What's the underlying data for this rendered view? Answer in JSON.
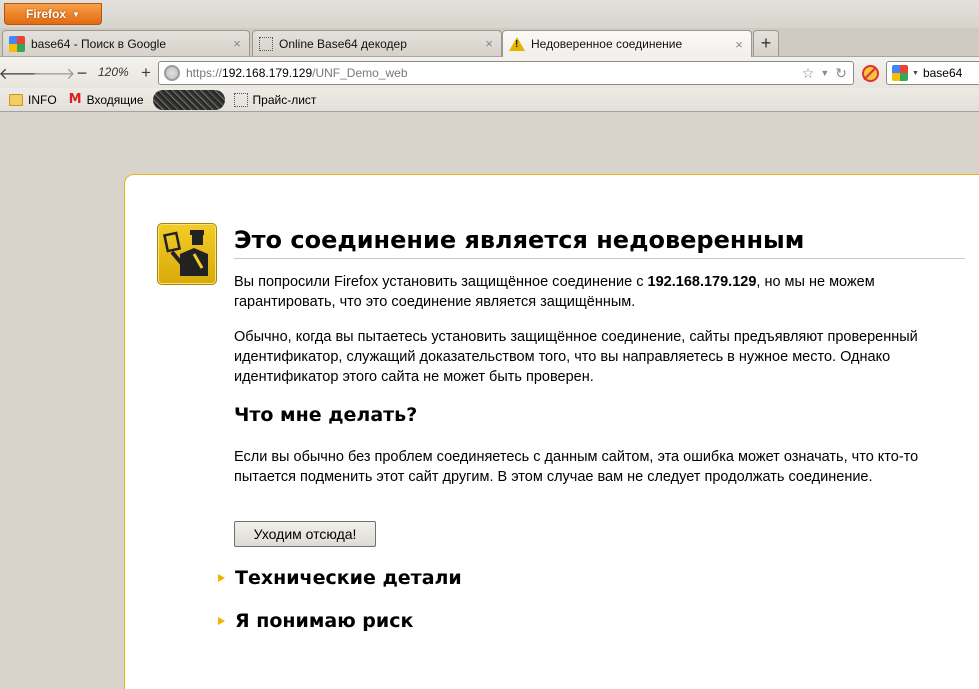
{
  "window": {
    "app_button_label": "Firefox"
  },
  "tabs": [
    {
      "label": "base64 - Поиск в Google",
      "favicon": "google-favicon"
    },
    {
      "label": "Online Base64 декодер",
      "favicon": "blank-page-icon"
    },
    {
      "label": "Недоверенное соединение",
      "favicon": "warning-icon",
      "active": true
    }
  ],
  "navbar": {
    "zoom": "120%",
    "zoom_minus": "−",
    "zoom_plus": "+",
    "url_scheme": "https://",
    "url_host": "192.168.179.129",
    "url_path": "/UNF_Demo_web",
    "search_text": "base64"
  },
  "bookmarks": [
    {
      "label": "INFO",
      "icon": "folder-icon"
    },
    {
      "label": "Входящие",
      "icon": "gmail-icon"
    },
    {
      "label": "Прайс-лист",
      "icon": "blank-page-icon"
    }
  ],
  "error_page": {
    "title": "Это соединение является недоверенным",
    "intro_before": "Вы попросили Firefox установить защищённое соединение с ",
    "intro_host": "192.168.179.129",
    "intro_after": ", но мы не можем гарантировать, что это соединение является защищённым.",
    "explanation": "Обычно, когда вы пытаетесь установить защищённое соединение, сайты предъявляют проверенный идентификатор, служащий доказательством того, что вы направляетесь в нужное место. Однако идентификатор этого сайта не может быть проверен.",
    "what_to_do_heading": "Что мне делать?",
    "what_to_do_text": "Если вы обычно без проблем соединяетесь с данным сайтом, эта ошибка может означать, что кто-то пытается подменить этот сайт другим. В этом случае вам не следует продолжать соединение.",
    "get_me_out_button": "Уходим отсюда!",
    "technical_details": "Технические детали",
    "understand_risks": "Я понимаю риск"
  },
  "colors": {
    "accent_orange": "#e26a10",
    "card_border": "#e8b51c",
    "expander_triangle": "#f2b200"
  }
}
